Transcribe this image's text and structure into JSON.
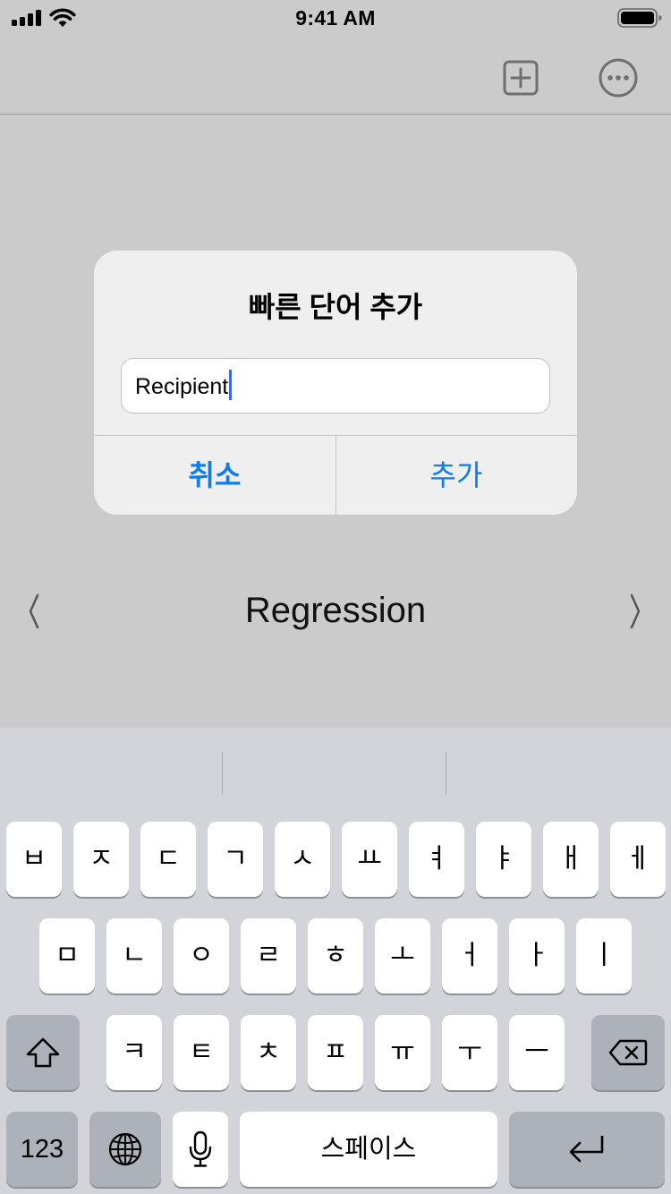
{
  "status_bar": {
    "time": "9:41 AM",
    "icons": [
      "cellular-signal-icon",
      "wifi-icon",
      "battery-icon"
    ]
  },
  "nav_bar": {
    "buttons": [
      "add-square-icon",
      "more-ellipsis-icon"
    ]
  },
  "main": {
    "word": "Regression",
    "prev_icon": "chevron-left-icon",
    "next_icon": "chevron-right-icon"
  },
  "alert": {
    "title": "빠른 단어 추가",
    "input_value": "Recipient",
    "cancel_label": "취소",
    "add_label": "추가",
    "button_color": "#0a7cf0"
  },
  "keyboard": {
    "row1": [
      "ㅂ",
      "ㅈ",
      "ㄷ",
      "ㄱ",
      "ㅅ",
      "ㅛ",
      "ㅕ",
      "ㅑ",
      "ㅐ",
      "ㅔ"
    ],
    "row2": [
      "ㅁ",
      "ㄴ",
      "ㅇ",
      "ㄹ",
      "ㅎ",
      "ㅗ",
      "ㅓ",
      "ㅏ",
      "ㅣ"
    ],
    "row3": [
      "ㅋ",
      "ㅌ",
      "ㅊ",
      "ㅍ",
      "ㅠ",
      "ㅜ",
      "ㅡ"
    ],
    "numbers_label": "123",
    "space_label": "스페이스",
    "special_icons": [
      "shift-icon",
      "delete-icon",
      "globe-icon",
      "microphone-icon",
      "return-icon"
    ]
  }
}
